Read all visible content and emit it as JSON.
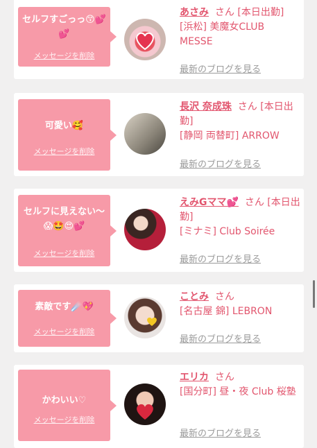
{
  "cards": [
    {
      "message": "セルフすごっっ😙💕💕",
      "delete_label": "メッセージを削除",
      "name": "あさみ",
      "honorific": "さん",
      "badge": "[本日出勤]",
      "area": "[浜松]",
      "shop": "美魔女CLUB MESSE",
      "blog_label": "最新のブログを見る",
      "avatar_icon": "heart-photo"
    },
    {
      "message": "可愛い🥰",
      "delete_label": "メッセージを削除",
      "name": "長沢 奈成珠",
      "honorific": "さん",
      "badge": "[本日出勤]",
      "area": "[静岡 両替町]",
      "shop": "ARROW",
      "blog_label": "最新のブログを見る",
      "avatar_icon": "person-photo"
    },
    {
      "message": "セルフに見えない〜😱🤩😍💕",
      "delete_label": "メッセージを削除",
      "name": "えみGママ💕",
      "honorific": "さん",
      "badge": "[本日出勤]",
      "area": "[ミナミ]",
      "shop": "Club Soirée",
      "blog_label": "最新のブログを見る",
      "avatar_icon": "person-photo"
    },
    {
      "message": "素敵です☄️💖",
      "delete_label": "メッセージを削除",
      "name": "ことみ",
      "honorific": "さん",
      "badge": "",
      "area": "[名古屋 錦]",
      "shop": "LEBRON",
      "blog_label": "最新のブログを見る",
      "avatar_icon": "heart-photo"
    },
    {
      "message": "かわいい♡",
      "delete_label": "メッセージを削除",
      "name": "エリカ",
      "honorific": "さん",
      "badge": "",
      "area": "[国分町]",
      "shop": "昼・夜 Club 桜塾",
      "blog_label": "最新のブログを見る",
      "avatar_icon": "heart-photo"
    }
  ],
  "colors": {
    "accent": "#e2566e",
    "bubble": "#f79aa8",
    "link_gray": "#9b9b9b",
    "background": "#f1f0f0"
  }
}
